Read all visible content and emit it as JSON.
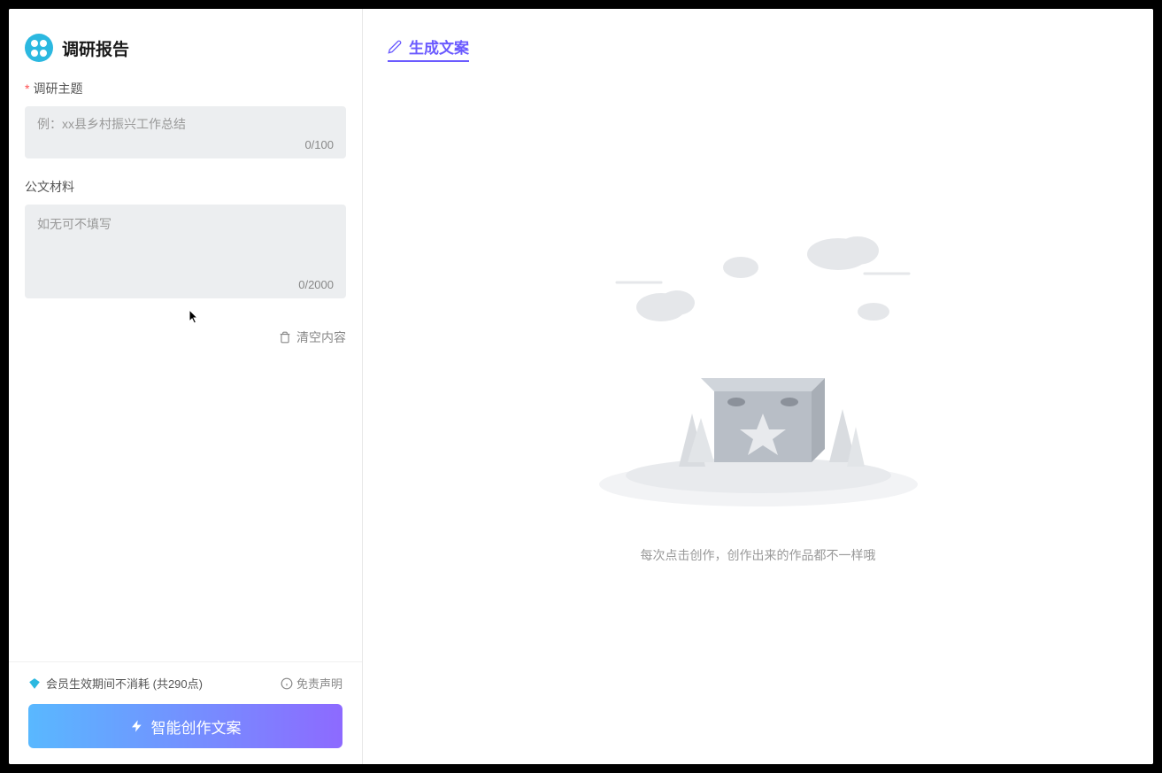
{
  "sidebar": {
    "title": "调研报告",
    "form": {
      "topic": {
        "label": "调研主题",
        "required": true,
        "placeholder": "例：xx县乡村振兴工作总结",
        "value": "",
        "count": "0/100"
      },
      "material": {
        "label": "公文材料",
        "required": false,
        "placeholder": "如无可不填写",
        "value": "",
        "count": "0/2000"
      }
    },
    "clear_label": "清空内容",
    "footer": {
      "points_text": "会员生效期间不消耗 (共290点)",
      "disclaimer_label": "免责声明",
      "generate_button": "智能创作文案"
    }
  },
  "main": {
    "header_title": "生成文案",
    "empty_state_text": "每次点击创作，创作出来的作品都不一样哦"
  }
}
